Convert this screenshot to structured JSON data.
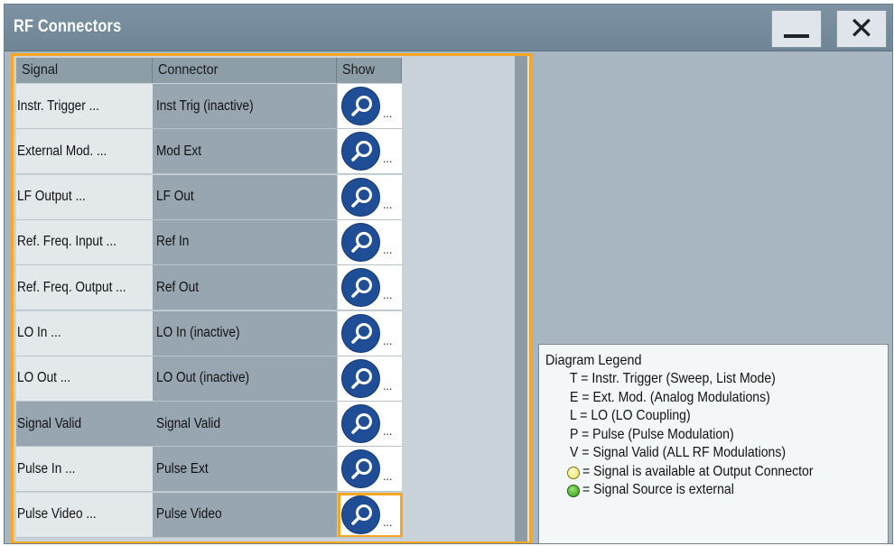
{
  "window": {
    "title": "RF Connectors"
  },
  "titlebar": {
    "minimize_icon": "minimize-icon",
    "close_icon": "close-icon"
  },
  "table": {
    "headers": {
      "signal": "Signal",
      "connector": "Connector",
      "show": "Show"
    },
    "show_icon": "magnifier-icon",
    "show_suffix": "...",
    "rows": [
      {
        "signal": "Instr. Trigger ...",
        "connector": "Inst Trig (inactive)"
      },
      {
        "signal": "External Mod. ...",
        "connector": "Mod Ext"
      },
      {
        "signal": "LF Output ...",
        "connector": "LF Out"
      },
      {
        "signal": "Ref. Freq. Input ...",
        "connector": "Ref In"
      },
      {
        "signal": "Ref. Freq. Output ...",
        "connector": "Ref Out"
      },
      {
        "signal": "LO In ...",
        "connector": "LO In (inactive)"
      },
      {
        "signal": "LO Out ...",
        "connector": "LO Out (inactive)"
      },
      {
        "signal": "Signal Valid",
        "connector": "Signal Valid"
      },
      {
        "signal": "Pulse In ...",
        "connector": "Pulse Ext"
      },
      {
        "signal": "Pulse Video ...",
        "connector": "Pulse Video"
      }
    ]
  },
  "legend": {
    "title": "Diagram Legend",
    "lines": [
      "T = Instr. Trigger (Sweep, List Mode)",
      "E = Ext. Mod. (Analog Modulations)",
      "L = LO (LO Coupling)",
      "P = Pulse (Pulse Modulation)",
      "V = Signal Valid (ALL RF Modulations)"
    ],
    "yellow_text": "= Signal is available at Output Connector",
    "green_text": "= Signal Source is external"
  },
  "colors": {
    "accent_focus": "#f5a623",
    "title_bar": "#7d93a3",
    "icon_blue": "#1f4e96"
  }
}
